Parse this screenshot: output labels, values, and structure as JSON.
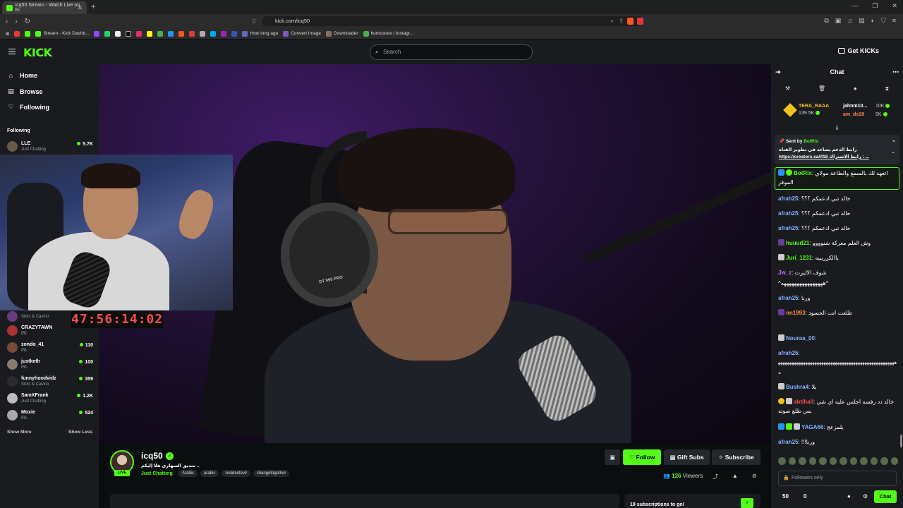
{
  "browser": {
    "tab_title": "icq50 Stream - Watch Live on Ki",
    "new_tab": "+",
    "url": "kick.com/icq50",
    "bookmarks": [
      "Stream - Kick Dashb...",
      "How long ago",
      "Convert Image",
      "Downloader",
      "huntcstore | Instagr..."
    ]
  },
  "header": {
    "logo": "KICK",
    "search_placeholder": "Search",
    "get_kicks": "Get KICKs"
  },
  "sidebar": {
    "nav": [
      {
        "label": "Home",
        "icon": "home-icon"
      },
      {
        "label": "Browse",
        "icon": "browse-icon"
      },
      {
        "label": "Following",
        "icon": "heart-icon"
      }
    ],
    "following_header": "Following",
    "channels": [
      {
        "name": "LLE",
        "category": "Just Chatting",
        "viewers": "5.7K"
      },
      {
        "name": "",
        "category": "Slots & Casino",
        "viewers": ""
      },
      {
        "name": "CRAZYTAWN",
        "category": "IRL",
        "viewers": ""
      },
      {
        "name": "zondo_41",
        "category": "IRL",
        "viewers": "110"
      },
      {
        "name": "justketh",
        "category": "IRL",
        "viewers": "100"
      },
      {
        "name": "funnyhoodvidz",
        "category": "Slots & Casino",
        "viewers": "359"
      },
      {
        "name": "SamXFrank",
        "category": "Just Chatting",
        "viewers": "1.2K"
      },
      {
        "name": "Moxie",
        "category": "IRL",
        "viewers": "524"
      }
    ],
    "show_more": "Show More",
    "show_less": "Show Less"
  },
  "video": {
    "timer": "47:56:14:02",
    "headphone_label": "DT 990 PRO"
  },
  "stream": {
    "name": "icq50",
    "title": "صديق السهارى هلا إليكم ..",
    "category": "Just Chatting",
    "tags": [
      "Arabic",
      "arabic",
      "residentevil",
      "changetogether"
    ],
    "live": "LIVE",
    "follow": "Follow",
    "gift_subs": "Gift Subs",
    "subscribe": "Subscribe",
    "viewers": "126",
    "viewers_label": "Viewers",
    "panel_text": "19 subscriptions to go!"
  },
  "chat": {
    "title": "Chat",
    "leaderboard": [
      {
        "name": "TERA_RAAA",
        "value": "139.5K"
      },
      {
        "name": "jahnm10...",
        "value": "10K"
      },
      {
        "name": "am_ds18",
        "value": "5K"
      }
    ],
    "pinned": {
      "sent_by": "Sent by",
      "bot": "BotRix",
      "text": "رابط الدعم يساعد في تطوير القناه",
      "link": "https://creators.sa/if18",
      "link_suffix": "رابط الاشتراك : ..."
    },
    "messages": [
      {
        "user": "BotRix",
        "color": "#53fc18",
        "text": "اتعهد لك بالسمع والطاعة مولاي الموقر"
      },
      {
        "user": "afrah25",
        "color": "#7fb3ff",
        "text": "خالد تبي ادعمكم ؟؟؟"
      },
      {
        "user": "afrah25",
        "color": "#7fb3ff",
        "text": "خالد تبي ادعمكم ؟؟؟"
      },
      {
        "user": "afrah25",
        "color": "#7fb3ff",
        "text": "خالد تبي ادعمكم ؟؟؟"
      },
      {
        "user": "huuud21",
        "color": "#53fc18",
        "text": "وش العلم معركة شنوووو"
      },
      {
        "user": "Juri_1231",
        "color": "#53fc18",
        "text": "ياالكرريبيه"
      },
      {
        "user": "Jw_z",
        "color": "#c56bff",
        "text": "شوف الاليرت"
      },
      {
        "user": "",
        "color": "#ffffff",
        "text": "^ههههههههههههههههه^"
      },
      {
        "user": "afrah25",
        "color": "#7fb3ff",
        "text": "ورنا"
      },
      {
        "user": "nn1993",
        "color": "#ff8a3d",
        "text": "طلعت انت الحسود"
      },
      {
        "user": "Nouraa_00",
        "color": "#7fb3ff",
        "text": ""
      },
      {
        "user": "afrah25",
        "color": "#7fb3ff",
        "text": "ههههههههههههههههههههههههههههههههههههههههههههههههههههه"
      },
      {
        "user": "Bushra4",
        "color": "#7fb3ff",
        "text": "بلا"
      },
      {
        "user": "abtihall",
        "color": "#ff4b4b",
        "text": "خالد دد رفسه اجلس عليه اي شي بس طلع صوته"
      },
      {
        "user": "YAGA66",
        "color": "#7fb3ff",
        "text": "يلمزعج"
      },
      {
        "user": "afrah25",
        "color": "#7fb3ff",
        "text": "ورنا!!!"
      }
    ],
    "input_placeholder": "Followers only",
    "points": "50",
    "points2": "0",
    "chat_button": "Chat"
  }
}
